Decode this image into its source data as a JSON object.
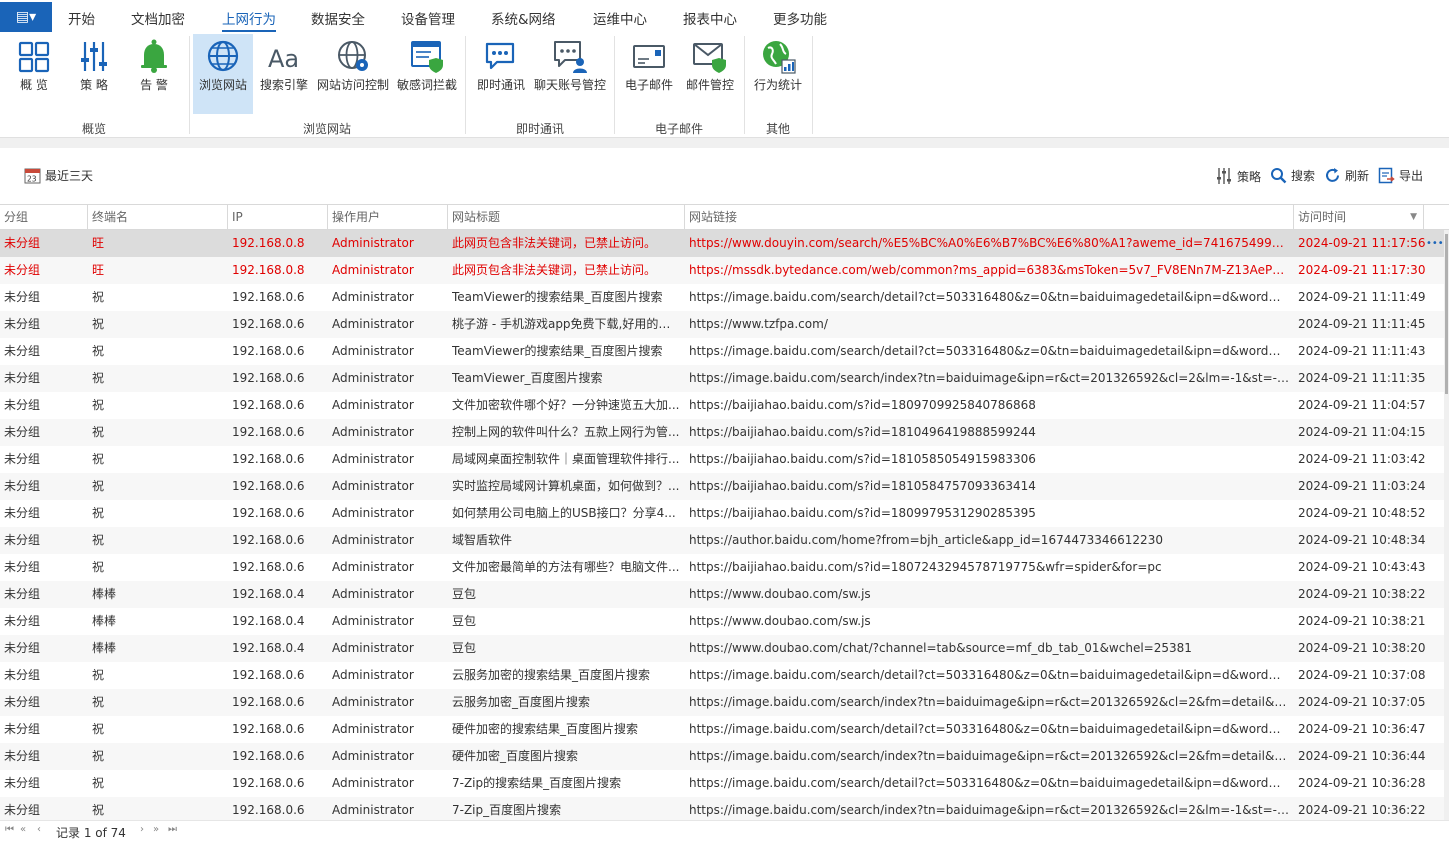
{
  "app": {
    "colors": {
      "accent": "#1a64b8",
      "danger": "#e00000",
      "selected_row": "#dcdcdc",
      "ribbon_active": "#cfe4f7"
    }
  },
  "menu": {
    "tabs": [
      "开始",
      "文档加密",
      "上网行为",
      "数据安全",
      "设备管理",
      "系统&网络",
      "运维中心",
      "报表中心",
      "更多功能"
    ],
    "active": "上网行为"
  },
  "ribbon": {
    "buttons": [
      {
        "label": "概 览",
        "icon": "dashboard-icon"
      },
      {
        "label": "策 略",
        "icon": "sliders-icon"
      },
      {
        "label": "告 警",
        "icon": "bell-icon"
      },
      {
        "label": "浏览网站",
        "icon": "globe-icon",
        "active": true
      },
      {
        "label": "搜索引擎",
        "icon": "text-aa-icon"
      },
      {
        "label": "网站访问控制",
        "icon": "globe-gear-icon"
      },
      {
        "label": "敏感词拦截",
        "icon": "window-shield-icon"
      },
      {
        "label": "即时通讯",
        "icon": "chat-icon"
      },
      {
        "label": "聊天账号管控",
        "icon": "chat-user-icon"
      },
      {
        "label": "电子邮件",
        "icon": "email-icon"
      },
      {
        "label": "邮件管控",
        "icon": "email-shield-icon"
      },
      {
        "label": "行为统计",
        "icon": "globe-stats-icon"
      }
    ],
    "groups": [
      "概览",
      "浏览网站",
      "即时通讯",
      "电子邮件",
      "其他"
    ]
  },
  "toolbar": {
    "date_range": "最近三天",
    "date_icon_text": "23",
    "policy": "策略",
    "search": "搜索",
    "refresh": "刷新",
    "export": "导出"
  },
  "grid": {
    "columns": [
      "分组",
      "终端名",
      "IP",
      "操作用户",
      "网站标题",
      "网站链接",
      "访问时间"
    ],
    "rows": [
      [
        "未分组",
        "旺",
        "192.168.0.8",
        "Administrator",
        "此网页包含非法关键词，已禁止访问。",
        "https://www.douyin.com/search/%E5%BC%A0%E6%B7%BC%E6%80%A1?aweme_id=7416754992163...",
        "2024-09-21 11:17:56",
        "danger"
      ],
      [
        "未分组",
        "旺",
        "192.168.0.8",
        "Administrator",
        "此网页包含非法关键词，已禁止访问。",
        "https://mssdk.bytedance.com/web/common?ms_appid=6383&msToken=5v7_FV8ENn7M-Z13AeP3ct...",
        "2024-09-21 11:17:30",
        "danger"
      ],
      [
        "未分组",
        "祝",
        "192.168.0.6",
        "Administrator",
        "TeamViewer的搜索结果_百度图片搜索",
        "https://image.baidu.com/search/detail?ct=503316480&z=0&tn=baiduimagedetail&ipn=d&word=Tea...",
        "2024-09-21 11:11:49",
        ""
      ],
      [
        "未分组",
        "祝",
        "192.168.0.6",
        "Administrator",
        "桃子游 - 手机游戏app免费下载,好用的手...",
        "https://www.tzfpa.com/",
        "2024-09-21 11:11:45",
        ""
      ],
      [
        "未分组",
        "祝",
        "192.168.0.6",
        "Administrator",
        "TeamViewer的搜索结果_百度图片搜索",
        "https://image.baidu.com/search/detail?ct=503316480&z=0&tn=baiduimagedetail&ipn=d&word=Tea...",
        "2024-09-21 11:11:43",
        ""
      ],
      [
        "未分组",
        "祝",
        "192.168.0.6",
        "Administrator",
        "TeamViewer_百度图片搜索",
        "https://image.baidu.com/search/index?tn=baiduimage&ipn=r&ct=201326592&cl=2&lm=-1&st=-1&f...",
        "2024-09-21 11:11:35",
        ""
      ],
      [
        "未分组",
        "祝",
        "192.168.0.6",
        "Administrator",
        "文件加密软件哪个好？一分钟速览五大加...",
        "https://baijiahao.baidu.com/s?id=1809709925840786868",
        "2024-09-21 11:04:57",
        ""
      ],
      [
        "未分组",
        "祝",
        "192.168.0.6",
        "Administrator",
        "控制上网的软件叫什么？五款上网行为管...",
        "https://baijiahao.baidu.com/s?id=1810496419888599244",
        "2024-09-21 11:04:15",
        ""
      ],
      [
        "未分组",
        "祝",
        "192.168.0.6",
        "Administrator",
        "局域网桌面控制软件｜桌面管理软件排行...",
        "https://baijiahao.baidu.com/s?id=1810585054915983306",
        "2024-09-21 11:03:42",
        ""
      ],
      [
        "未分组",
        "祝",
        "192.168.0.6",
        "Administrator",
        "实时监控局域网计算机桌面，如何做到？...",
        "https://baijiahao.baidu.com/s?id=1810584757093363414",
        "2024-09-21 11:03:24",
        ""
      ],
      [
        "未分组",
        "祝",
        "192.168.0.6",
        "Administrator",
        "如何禁用公司电脑上的USB接口？分享4...",
        "https://baijiahao.baidu.com/s?id=1809979531290285395",
        "2024-09-21 10:48:52",
        ""
      ],
      [
        "未分组",
        "祝",
        "192.168.0.6",
        "Administrator",
        "域智盾软件",
        "https://author.baidu.com/home?from=bjh_article&app_id=1674473346612230",
        "2024-09-21 10:48:34",
        ""
      ],
      [
        "未分组",
        "祝",
        "192.168.0.6",
        "Administrator",
        "文件加密最简单的方法有哪些？电脑文件...",
        "https://baijiahao.baidu.com/s?id=1807243294578719775&wfr=spider&for=pc",
        "2024-09-21 10:43:43",
        ""
      ],
      [
        "未分组",
        "棒棒",
        "192.168.0.4",
        "Administrator",
        "豆包",
        "https://www.doubao.com/sw.js",
        "2024-09-21 10:38:22",
        ""
      ],
      [
        "未分组",
        "棒棒",
        "192.168.0.4",
        "Administrator",
        "豆包",
        "https://www.doubao.com/sw.js",
        "2024-09-21 10:38:21",
        ""
      ],
      [
        "未分组",
        "棒棒",
        "192.168.0.4",
        "Administrator",
        "豆包",
        "https://www.doubao.com/chat/?channel=tab&source=mf_db_tab_01&wchel=25381",
        "2024-09-21 10:38:20",
        ""
      ],
      [
        "未分组",
        "祝",
        "192.168.0.6",
        "Administrator",
        "云服务加密的搜索结果_百度图片搜索",
        "https://image.baidu.com/search/detail?ct=503316480&z=0&tn=baiduimagedetail&ipn=d&word=%E...",
        "2024-09-21 10:37:08",
        ""
      ],
      [
        "未分组",
        "祝",
        "192.168.0.6",
        "Administrator",
        "云服务加密_百度图片搜索",
        "https://image.baidu.com/search/index?tn=baiduimage&ipn=r&ct=201326592&cl=2&fm=detail&lm=...",
        "2024-09-21 10:37:05",
        ""
      ],
      [
        "未分组",
        "祝",
        "192.168.0.6",
        "Administrator",
        "硬件加密的搜索结果_百度图片搜索",
        "https://image.baidu.com/search/detail?ct=503316480&z=0&tn=baiduimagedetail&ipn=d&word=%E...",
        "2024-09-21 10:36:47",
        ""
      ],
      [
        "未分组",
        "祝",
        "192.168.0.6",
        "Administrator",
        "硬件加密_百度图片搜索",
        "https://image.baidu.com/search/index?tn=baiduimage&ipn=r&ct=201326592&cl=2&fm=detail&lm=...",
        "2024-09-21 10:36:44",
        ""
      ],
      [
        "未分组",
        "祝",
        "192.168.0.6",
        "Administrator",
        "7-Zip的搜索结果_百度图片搜索",
        "https://image.baidu.com/search/detail?ct=503316480&z=0&tn=baiduimagedetail&ipn=d&word=7-Z...",
        "2024-09-21 10:36:28",
        ""
      ],
      [
        "未分组",
        "祝",
        "192.168.0.6",
        "Administrator",
        "7-Zip_百度图片搜索",
        "https://image.baidu.com/search/index?tn=baiduimage&ipn=r&ct=201326592&cl=2&lm=-1&st=-1&f...",
        "2024-09-21 10:36:22",
        ""
      ]
    ],
    "row_more": "•••"
  },
  "pager": {
    "text": "记录 1 of 74"
  }
}
